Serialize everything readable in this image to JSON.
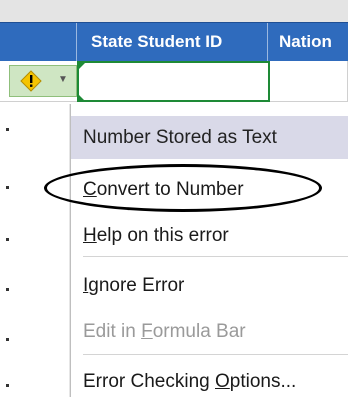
{
  "header": {
    "col_state": "State Student ID",
    "col_nation": "Nation"
  },
  "error_menu": {
    "title": "Number Stored as Text",
    "convert": {
      "accel": "C",
      "rest": "onvert to Number"
    },
    "help": {
      "accel": "H",
      "rest": "elp on this error"
    },
    "ignore": {
      "accel": "I",
      "rest": "gnore Error"
    },
    "edit": {
      "pre": "Edit in ",
      "accel": "F",
      "rest": "ormula Bar"
    },
    "options": {
      "pre": "Error Checking ",
      "accel": "O",
      "rest": "ptions..."
    }
  },
  "icons": {
    "warning": "warning-diamond-icon",
    "dropdown": "chevron-down-icon"
  },
  "colors": {
    "header_bg": "#2f6bbd",
    "selection_border": "#1e8a36",
    "menu_highlight": "#d9d9e8",
    "warning_yellow": "#f5c400"
  }
}
